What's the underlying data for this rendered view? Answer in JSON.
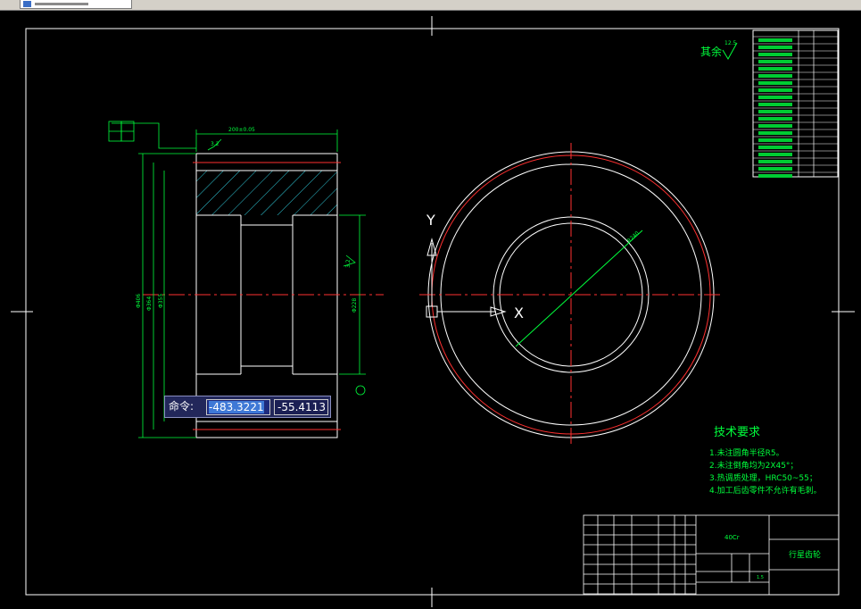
{
  "colors": {
    "background": "#000000",
    "frame": "#ffffff",
    "dimension": "#00ff00",
    "centerline": "#ff3030",
    "hatch": "#2fc8d8",
    "command_box": "#22275a"
  },
  "window": {
    "tab_icon": "cad-file-icon"
  },
  "command_line": {
    "label": "命令:",
    "x_value": "-483.3221",
    "y_value": "-55.4113"
  },
  "drawing": {
    "roughness_note": "其余",
    "roughness_value": "12.5",
    "technical_requirements": {
      "title": "技术要求",
      "items": [
        "1.未注圆角半径R5。",
        "2.未注倒角均为2X45°；",
        "3.热调质处理，HRC50~55；",
        "4.加工后齿零件不允许有毛刺。"
      ]
    },
    "title_block": {
      "material": "40Cr",
      "part_name": "行星齿轮",
      "scale": "1.5"
    },
    "ucs": {
      "x_label": "X",
      "y_label": "Y"
    },
    "dimensions": {
      "overall_width": "200±0.05",
      "diameter_main": "Φ406",
      "bore_dia": "Φ228",
      "dia_a": "Φ364",
      "dia_b": "Φ355",
      "radius": "R240",
      "roughness_top": "3.2",
      "roughness_side": "3.2"
    }
  }
}
